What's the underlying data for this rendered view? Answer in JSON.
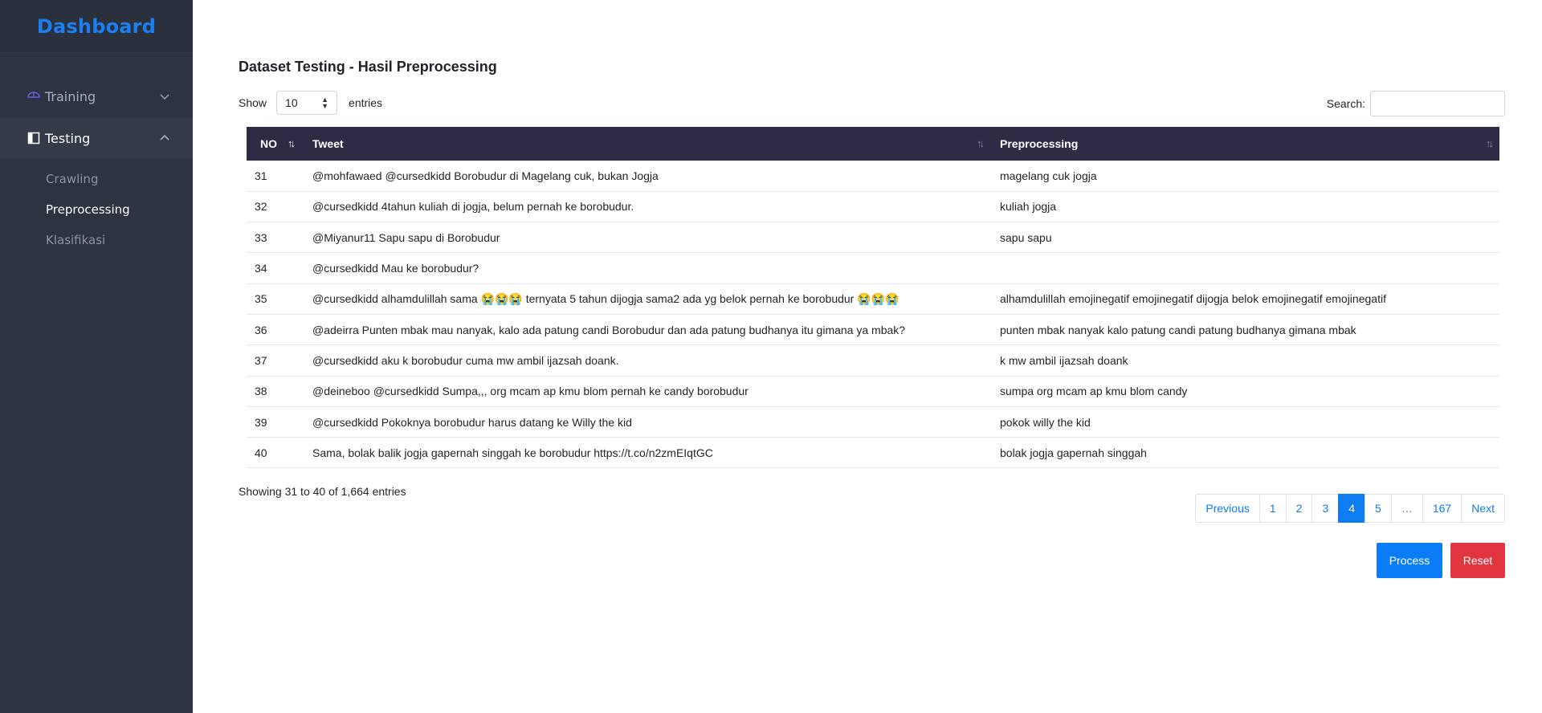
{
  "sidebar": {
    "brand": "Dashboard",
    "items": [
      {
        "label": "Training",
        "icon": "umbrella-icon",
        "expanded": false
      },
      {
        "label": "Testing",
        "icon": "sidebar-layout-icon",
        "expanded": true,
        "children": [
          {
            "label": "Crawling",
            "current": false
          },
          {
            "label": "Preprocessing",
            "current": true
          },
          {
            "label": "Klasifikasi",
            "current": false
          }
        ]
      }
    ]
  },
  "main": {
    "title": "Dataset Testing - Hasil Preprocessing",
    "length": {
      "prefix": "Show",
      "value": "10",
      "suffix": "entries"
    },
    "search": {
      "label": "Search:",
      "value": ""
    },
    "table": {
      "headers": [
        "NO",
        "Tweet",
        "Preprocessing"
      ],
      "rows": [
        {
          "no": "31",
          "tweet": "@mohfawaed @cursedkidd Borobudur di Magelang cuk, bukan Jogja",
          "pre": "magelang cuk jogja"
        },
        {
          "no": "32",
          "tweet": "@cursedkidd 4tahun kuliah di jogja, belum pernah ke borobudur.",
          "pre": "kuliah jogja"
        },
        {
          "no": "33",
          "tweet": "@Miyanur11 Sapu sapu di Borobudur",
          "pre": "sapu sapu"
        },
        {
          "no": "34",
          "tweet": "@cursedkidd Mau ke borobudur?",
          "pre": ""
        },
        {
          "no": "35",
          "tweet": "@cursedkidd alhamdulillah sama 😭😭😭 ternyata 5 tahun dijogja sama2 ada yg belok pernah ke borobudur 😭😭😭",
          "pre": "alhamdulillah emojinegatif emojinegatif dijogja belok emojinegatif emojinegatif"
        },
        {
          "no": "36",
          "tweet": "@adeirra Punten mbak mau nanyak, kalo ada patung candi Borobudur dan ada patung budhanya itu gimana ya mbak?",
          "pre": "punten mbak nanyak kalo patung candi patung budhanya gimana mbak"
        },
        {
          "no": "37",
          "tweet": "@cursedkidd aku k borobudur cuma mw ambil ijazsah doank.",
          "pre": "k mw ambil ijazsah doank"
        },
        {
          "no": "38",
          "tweet": "@deineboo @cursedkidd Sumpa,,, org mcam ap kmu blom pernah ke candy borobudur",
          "pre": "sumpa org mcam ap kmu blom candy"
        },
        {
          "no": "39",
          "tweet": "@cursedkidd Pokoknya borobudur harus datang ke Willy the kid",
          "pre": "pokok willy the kid"
        },
        {
          "no": "40",
          "tweet": "Sama, bolak balik jogja gapernah singgah ke borobudur https://t.co/n2zmEIqtGC",
          "pre": "bolak jogja gapernah singgah"
        }
      ]
    },
    "info": "Showing 31 to 40 of 1,664 entries",
    "pagination": {
      "previous": "Previous",
      "pages": [
        "1",
        "2",
        "3",
        "4",
        "5",
        "…",
        "167"
      ],
      "current": "4",
      "next": "Next"
    },
    "actions": {
      "process": "Process",
      "reset": "Reset"
    }
  },
  "colors": {
    "sidebar_bg": "#2d3340",
    "brand": "#1a7ff0",
    "table_header": "#302b45",
    "primary": "#0d7df1",
    "danger": "#e0343f"
  }
}
